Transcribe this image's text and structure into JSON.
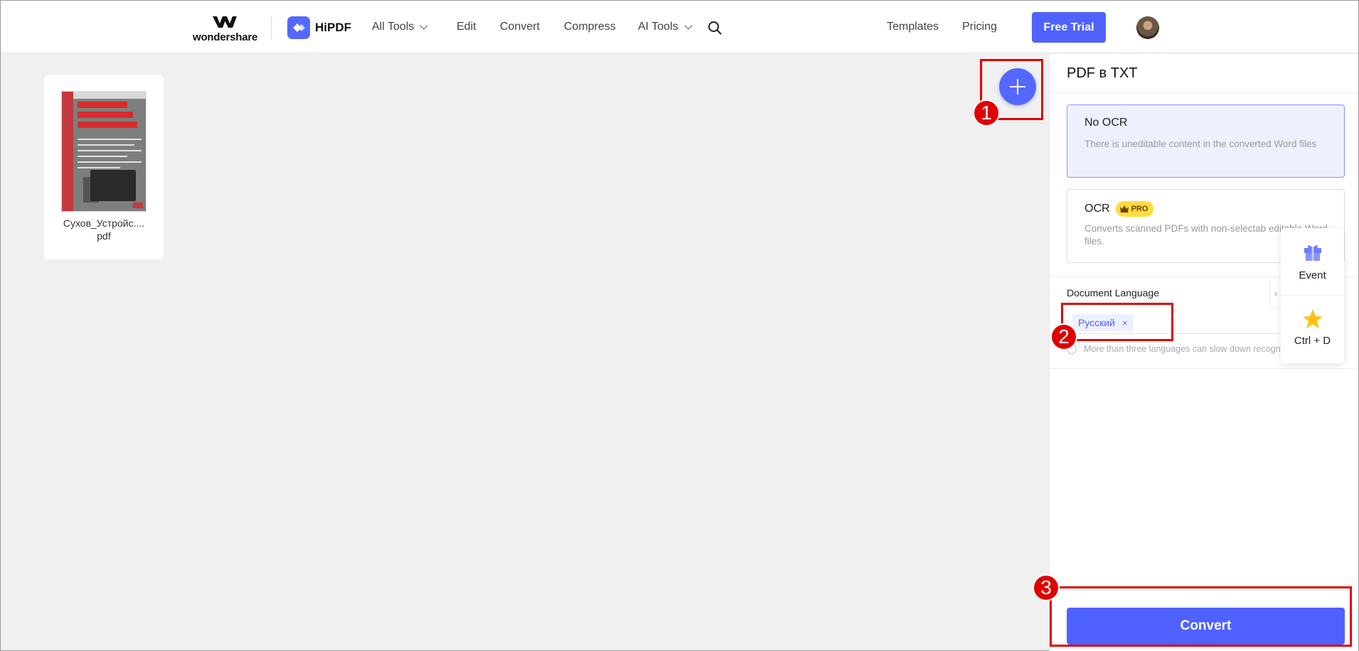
{
  "header": {
    "brand": "wondershare",
    "product": "HiPDF",
    "nav": [
      {
        "label": "All Tools"
      },
      {
        "label": "Edit"
      },
      {
        "label": "Convert"
      },
      {
        "label": "Compress"
      },
      {
        "label": "AI Tools"
      }
    ],
    "templates": "Templates",
    "pricing": "Pricing",
    "free_trial": "Free Trial"
  },
  "file": {
    "name": "Сухов_Устройс....\npdf"
  },
  "panel": {
    "title": "PDF в TXT",
    "options": [
      {
        "title": "No OCR",
        "desc": "There is uneditable content in the converted Word files"
      },
      {
        "title": "OCR",
        "badge": "PRO",
        "desc": "Converts scanned PDFs with non-selectab editable Word files."
      }
    ],
    "language_label": "Document Language",
    "language_tag": "Русский",
    "language_tag_remove": "×",
    "hint": "More than three languages can slow down recogn",
    "convert": "Convert"
  },
  "widget": {
    "event": "Event",
    "bookmark": "Ctrl + D"
  },
  "annotations": [
    "1",
    "2",
    "3"
  ],
  "colors": {
    "accent": "#4f62ff",
    "annotation": "#e00000",
    "pro_badge": "#ffdc3d"
  }
}
